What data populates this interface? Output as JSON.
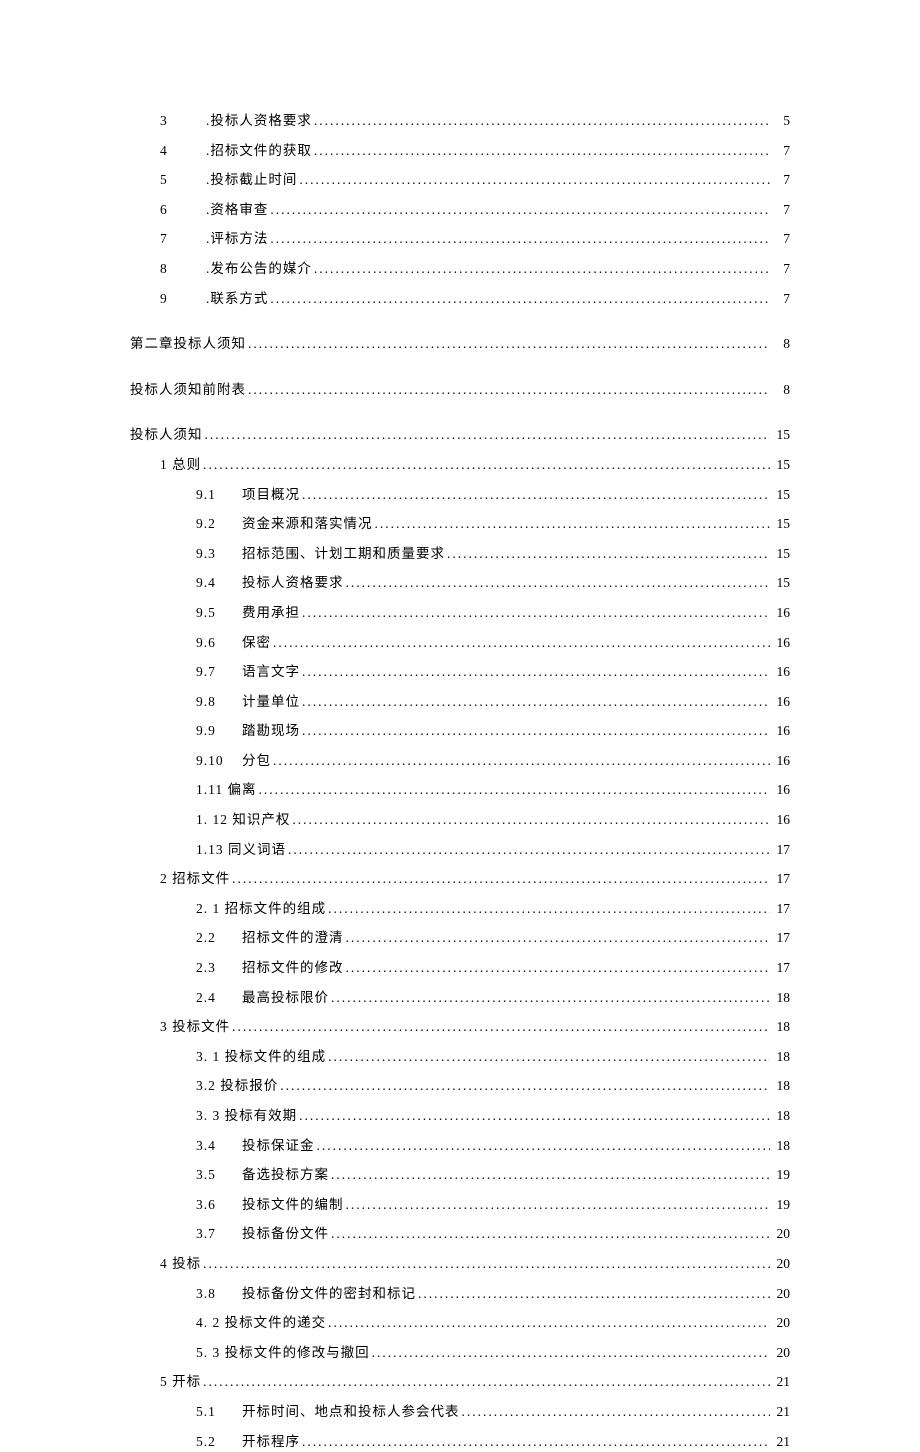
{
  "toc": [
    {
      "level": "lvl1",
      "num": "3",
      "title": ".投标人资格要求",
      "page": "5",
      "spaced": false,
      "numWide": true
    },
    {
      "level": "lvl1",
      "num": "4",
      "title": ".招标文件的获取",
      "page": "7",
      "spaced": false,
      "numWide": true
    },
    {
      "level": "lvl1",
      "num": "5",
      "title": ".投标截止时间",
      "page": "7",
      "spaced": false,
      "numWide": true
    },
    {
      "level": "lvl1",
      "num": "6",
      "title": ".资格审查",
      "page": "7",
      "spaced": false,
      "numWide": true
    },
    {
      "level": "lvl1",
      "num": "7",
      "title": ".评标方法",
      "page": "7",
      "spaced": false,
      "numWide": true
    },
    {
      "level": "lvl1",
      "num": "8",
      "title": ".发布公告的媒介",
      "page": "7",
      "spaced": false,
      "numWide": true
    },
    {
      "level": "lvl1",
      "num": "9",
      "title": ".联系方式",
      "page": "7",
      "spaced": false,
      "numWide": true
    },
    {
      "level": "lvl0",
      "num": "",
      "title": "第二章投标人须知",
      "page": "8",
      "spaced": true
    },
    {
      "level": "lvl0",
      "num": "",
      "title": "投标人须知前附表",
      "page": "8",
      "spaced": true
    },
    {
      "level": "lvl0",
      "num": "",
      "title": "投标人须知",
      "page": "15",
      "spaced": true
    },
    {
      "level": "lvl1",
      "num": "",
      "title": "1 总则",
      "page": "15",
      "spaced": false
    },
    {
      "level": "lvl2",
      "num": "9.1",
      "title": "项目概况",
      "page": "15",
      "spaced": false,
      "numWide": true
    },
    {
      "level": "lvl2",
      "num": "9.2",
      "title": "资金来源和落实情况",
      "page": "15",
      "spaced": false,
      "numWide": true
    },
    {
      "level": "lvl2",
      "num": "9.3",
      "title": "招标范围、计划工期和质量要求",
      "page": "15",
      "spaced": false,
      "numWide": true
    },
    {
      "level": "lvl2",
      "num": "9.4",
      "title": "投标人资格要求",
      "page": "15",
      "spaced": false,
      "numWide": true
    },
    {
      "level": "lvl2",
      "num": "9.5",
      "title": "费用承担",
      "page": "16",
      "spaced": false,
      "numWide": true
    },
    {
      "level": "lvl2",
      "num": "9.6",
      "title": "保密",
      "page": "16",
      "spaced": false,
      "numWide": true
    },
    {
      "level": "lvl2",
      "num": "9.7",
      "title": "语言文字",
      "page": "16",
      "spaced": false,
      "numWide": true
    },
    {
      "level": "lvl2",
      "num": "9.8",
      "title": "计量单位",
      "page": "16",
      "spaced": false,
      "numWide": true
    },
    {
      "level": "lvl2",
      "num": "9.9",
      "title": "踏勘现场",
      "page": "16",
      "spaced": false,
      "numWide": true
    },
    {
      "level": "lvl2",
      "num": "9.10",
      "title": "  分包",
      "page": "16",
      "spaced": false,
      "numWide": true
    },
    {
      "level": "lvl2",
      "num": "",
      "title": "1.11 偏离",
      "page": "16",
      "spaced": false
    },
    {
      "level": "lvl2",
      "num": "",
      "title": "1.   12 知识产权",
      "page": "16",
      "spaced": false
    },
    {
      "level": "lvl2",
      "num": "",
      "title": "1.13 同义词语",
      "page": "17",
      "spaced": false
    },
    {
      "level": "lvl1",
      "num": "",
      "title": "2 招标文件",
      "page": "17",
      "spaced": false
    },
    {
      "level": "lvl2",
      "num": "",
      "title": "2.   1 招标文件的组成",
      "page": "17",
      "spaced": false
    },
    {
      "level": "lvl2",
      "num": "2.2",
      "title": "招标文件的澄清",
      "page": "17",
      "spaced": false,
      "numWide": true
    },
    {
      "level": "lvl2",
      "num": "2.3",
      "title": "招标文件的修改",
      "page": "17",
      "spaced": false,
      "numWide": true
    },
    {
      "level": "lvl2",
      "num": "2.4",
      "title": "最高投标限价",
      "page": "18",
      "spaced": false,
      "numWide": true
    },
    {
      "level": "lvl1",
      "num": "",
      "title": "3 投标文件",
      "page": "18",
      "spaced": false
    },
    {
      "level": "lvl2",
      "num": "",
      "title": "3.   1 投标文件的组成",
      "page": "18",
      "spaced": false
    },
    {
      "level": "lvl2",
      "num": "",
      "title": "3.2 投标报价",
      "page": "18",
      "spaced": false
    },
    {
      "level": "lvl2",
      "num": "",
      "title": "3.   3 投标有效期",
      "page": "18",
      "spaced": false
    },
    {
      "level": "lvl2",
      "num": "3.4",
      "title": "投标保证金",
      "page": "18",
      "spaced": false,
      "numWide": true
    },
    {
      "level": "lvl2",
      "num": "3.5",
      "title": "备选投标方案",
      "page": "19",
      "spaced": false,
      "numWide": true
    },
    {
      "level": "lvl2",
      "num": "3.6",
      "title": "投标文件的编制",
      "page": "19",
      "spaced": false,
      "numWide": true
    },
    {
      "level": "lvl2",
      "num": "3.7",
      "title": "投标备份文件",
      "page": "20",
      "spaced": false,
      "numWide": true
    },
    {
      "level": "lvl1",
      "num": "",
      "title": "4 投标",
      "page": "20",
      "spaced": false
    },
    {
      "level": "lvl2",
      "num": "3.8",
      "title": "投标备份文件的密封和标记",
      "page": "20",
      "spaced": false,
      "numWide": true
    },
    {
      "level": "lvl2",
      "num": "",
      "title": "4.   2 投标文件的递交",
      "page": "20",
      "spaced": false
    },
    {
      "level": "lvl2",
      "num": "",
      "title": "5.   3 投标文件的修改与撤回",
      "page": "20",
      "spaced": false
    },
    {
      "level": "lvl1",
      "num": "",
      "title": "5 开标",
      "page": "21",
      "spaced": false
    },
    {
      "level": "lvl2",
      "num": "5.1",
      "title": "开标时间、地点和投标人参会代表",
      "page": "21",
      "spaced": false,
      "numWide": true
    },
    {
      "level": "lvl2",
      "num": "5.2",
      "title": "开标程序",
      "page": "21",
      "spaced": false,
      "numWide": true
    }
  ]
}
